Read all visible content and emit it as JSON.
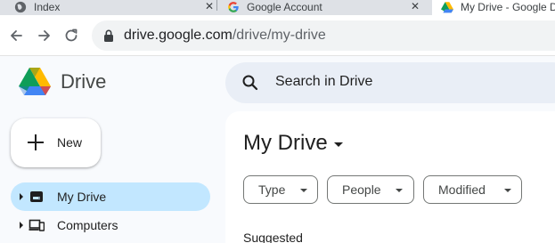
{
  "browser": {
    "tabs": [
      {
        "title": "Index",
        "icon": "globe-icon",
        "active": false
      },
      {
        "title": "Google Account",
        "icon": "google-g-icon",
        "active": false
      },
      {
        "title": "My Drive - Google Drive",
        "icon": "drive-logo-icon",
        "active": true
      }
    ],
    "tab_close_glyph": "✕",
    "url_host": "drive.google.com",
    "url_path": "/drive/my-drive"
  },
  "drive": {
    "brand_name": "Drive",
    "search_placeholder": "Search in Drive",
    "new_button_label": "New",
    "nav_items": [
      {
        "label": "My Drive",
        "icon": "drive-folder-icon",
        "active": true
      },
      {
        "label": "Computers",
        "icon": "computers-icon",
        "active": false
      }
    ],
    "page_title": "My Drive",
    "filters": [
      {
        "label": "Type"
      },
      {
        "label": "People"
      },
      {
        "label": "Modified"
      }
    ],
    "section_label": "Suggested"
  },
  "colors": {
    "active_nav": "#c2e7ff",
    "search_bg": "#e9eef6",
    "app_bg": "#f8fafd",
    "logo_blue": "#4285f4",
    "logo_green": "#0f9d58",
    "logo_yellow": "#ffba00"
  }
}
